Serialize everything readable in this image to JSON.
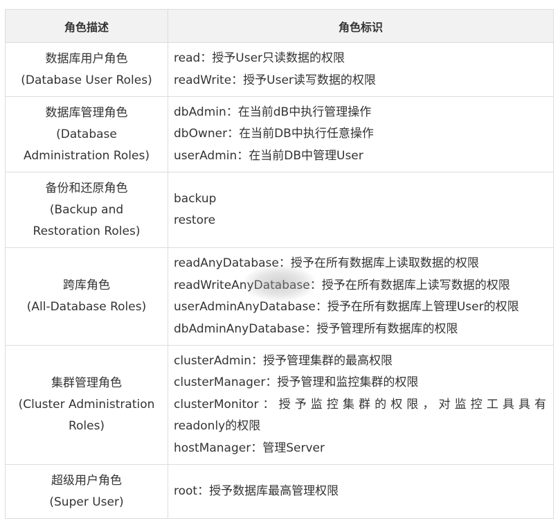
{
  "header": {
    "col1": "角色描述",
    "col2": "角色标识"
  },
  "rows": [
    {
      "cn": "数据库用户角色",
      "en": [
        "(Database User Roles)"
      ],
      "lines": [
        "read：授予User只读数据的权限",
        "readWrite：授予User读写数据的权限"
      ]
    },
    {
      "cn": "数据库管理角色",
      "en": [
        "(Database",
        "Administration Roles)"
      ],
      "lines": [
        "dbAdmin：在当前dB中执行管理操作",
        "dbOwner：在当前DB中执行任意操作",
        "userAdmin：在当前DB中管理User"
      ]
    },
    {
      "cn": "备份和还原角色",
      "en": [
        "(Backup and",
        "Restoration Roles)"
      ],
      "lines": [
        "backup",
        "restore"
      ]
    },
    {
      "cn": "跨库角色",
      "en": [
        "(All-Database Roles)"
      ],
      "lines": [
        "readAnyDatabase：授予在所有数据库上读取数据的权限",
        "readWriteAnyDatabase：授予在所有数据库上读写数据的权限",
        "userAdminAnyDatabase：授予在所有数据库上管理User的权限",
        "dbAdminAnyDatabase：授予管理所有数据库的权限"
      ]
    },
    {
      "cn": "集群管理角色",
      "en": [
        "(Cluster Administration",
        "Roles)"
      ],
      "lines": [
        "clusterAdmin：授予管理集群的最高权限",
        "clusterManager：授予管理和监控集群的权限",
        "clusterMonitor：授予监控集群的权限，对监控工具具有",
        "readonly的权限",
        "hostManager：管理Server"
      ]
    },
    {
      "cn": "超级用户角色",
      "en": [
        "(Super User)"
      ],
      "lines": [
        "root：授予数据库最高管理权限"
      ]
    }
  ]
}
